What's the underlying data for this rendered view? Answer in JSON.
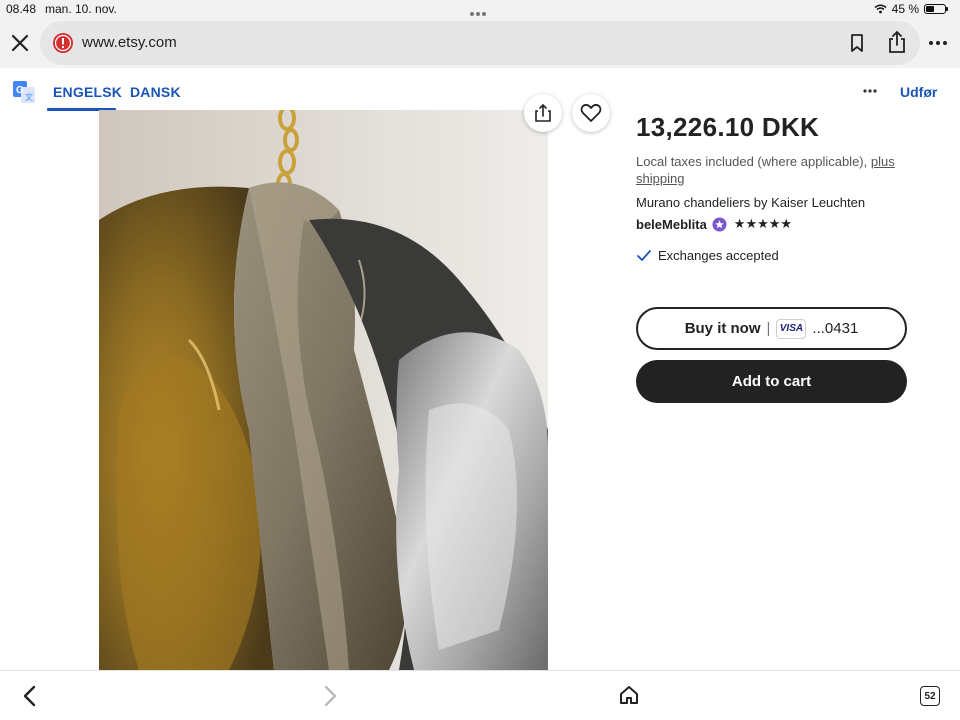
{
  "status_bar": {
    "time": "08.48",
    "date": "man. 10. nov.",
    "battery_text": "45 %",
    "battery_level": 0.45
  },
  "browser": {
    "url": "www.etsy.com",
    "icons": [
      "close-icon",
      "warning-icon",
      "bookmark-icon",
      "share-icon",
      "more-icon"
    ]
  },
  "translate_bar": {
    "tab_source": "ENGELSK",
    "tab_target": "DANSK",
    "done": "Udfør",
    "active_tab": "ENGELSK"
  },
  "product": {
    "price": "13,226.10 DKK",
    "tax_text": "Local taxes included (where applicable), ",
    "tax_link": "plus shipping",
    "title": "Murano chandeliers by Kaiser Leuchten",
    "seller": "beleMeblita",
    "rating_stars": "★★★★★",
    "rating": 5,
    "exchanges": "Exchanges accepted",
    "buy_now": "Buy it now",
    "buy_sep": "|",
    "card_brand": "VISA",
    "card_digits": "...0431",
    "add_to_cart": "Add to cart"
  },
  "bottom_bar": {
    "tab_count": "52"
  },
  "colors": {
    "accent_blue": "#1a55b8",
    "cart_button": "#222222",
    "warning_red": "#d32f2f",
    "star_seller_purple": "#7b57c9"
  }
}
